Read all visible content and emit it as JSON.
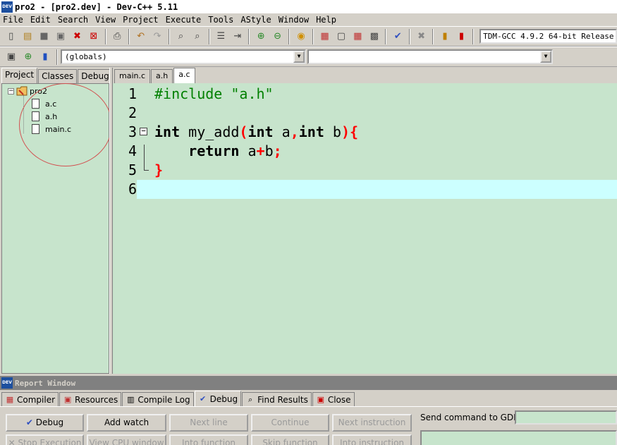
{
  "window": {
    "title": "pro2 - [pro2.dev] - Dev-C++ 5.11",
    "icon_label": "DEV"
  },
  "menu": [
    "File",
    "Edit",
    "Search",
    "View",
    "Project",
    "Execute",
    "Tools",
    "AStyle",
    "Window",
    "Help"
  ],
  "toolbar": {
    "compiler": "TDM-GCC 4.9.2 64-bit Release",
    "scope_combo": "(globals)",
    "members_combo": ""
  },
  "left_tabs": [
    "Project",
    "Classes",
    "Debug"
  ],
  "project_tree": {
    "root": "pro2",
    "files": [
      "a.c",
      "a.h",
      "main.c"
    ]
  },
  "file_tabs": [
    "main.c",
    "a.h",
    "a.c"
  ],
  "editor": {
    "line_numbers": [
      "1",
      "2",
      "3",
      "4",
      "5",
      "6"
    ],
    "current_line": 6
  },
  "report": {
    "title": "Report Window",
    "tabs": [
      "Compiler",
      "Resources",
      "Compile Log",
      "Debug",
      "Find Results",
      "Close"
    ],
    "active_tab": "Debug"
  },
  "debug_panel": {
    "row1": [
      "Debug",
      "Add watch",
      "Next line",
      "Continue",
      "Next instruction"
    ],
    "row2": [
      "Stop Execution",
      "View CPU window",
      "Into function",
      "Skip function",
      "Into instruction"
    ],
    "gdb_label": "Send command to GDB:"
  },
  "colors": {
    "editor_bg": "#c7e4cc",
    "current_line_bg": "#ccffff",
    "preprocessor": "#008000",
    "symbol": "#ff0000",
    "annotation_circle": "#d25050"
  }
}
